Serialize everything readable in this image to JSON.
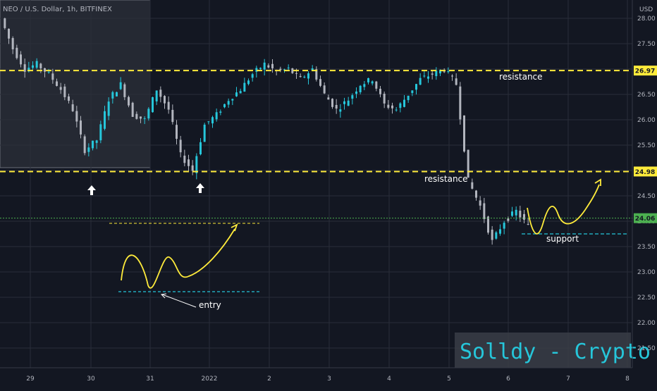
{
  "chart_data": {
    "type": "candlestick",
    "symbol_label": "NEO / U.S. Dollar, 1h, BITFINEX",
    "currency_label": "USD",
    "ylim": [
      21.2,
      28.3
    ],
    "y_ticks": [
      "28.00",
      "27.50",
      "27.00",
      "26.50",
      "26.00",
      "25.50",
      "25.00",
      "24.50",
      "24.00",
      "23.50",
      "23.00",
      "22.50",
      "22.00",
      "21.50"
    ],
    "x_ticks": [
      "29",
      "30",
      "31",
      "2022",
      "2",
      "3",
      "4",
      "5",
      "6",
      "7",
      "8"
    ],
    "candles": [
      {
        "p": 28.0,
        "c": "up"
      },
      {
        "p": 27.4,
        "c": "down"
      },
      {
        "p": 27.0,
        "c": "down"
      },
      {
        "p": 27.1,
        "c": "up"
      },
      {
        "p": 26.9,
        "c": "down"
      },
      {
        "p": 26.6,
        "c": "down"
      },
      {
        "p": 26.2,
        "c": "down"
      },
      {
        "p": 25.4,
        "c": "down"
      },
      {
        "p": 25.6,
        "c": "up"
      },
      {
        "p": 26.4,
        "c": "up"
      },
      {
        "p": 26.7,
        "c": "up"
      },
      {
        "p": 26.1,
        "c": "down"
      },
      {
        "p": 26.0,
        "c": "up"
      },
      {
        "p": 26.6,
        "c": "up"
      },
      {
        "p": 26.2,
        "c": "down"
      },
      {
        "p": 25.3,
        "c": "down"
      },
      {
        "p": 25.0,
        "c": "down"
      },
      {
        "p": 25.9,
        "c": "up"
      },
      {
        "p": 26.1,
        "c": "up"
      },
      {
        "p": 26.4,
        "c": "up"
      },
      {
        "p": 26.6,
        "c": "up"
      },
      {
        "p": 26.9,
        "c": "up"
      },
      {
        "p": 27.1,
        "c": "up"
      },
      {
        "p": 26.95,
        "c": "down"
      },
      {
        "p": 27.0,
        "c": "up"
      },
      {
        "p": 26.8,
        "c": "down"
      },
      {
        "p": 27.0,
        "c": "up"
      },
      {
        "p": 26.5,
        "c": "down"
      },
      {
        "p": 26.2,
        "c": "down"
      },
      {
        "p": 26.4,
        "c": "up"
      },
      {
        "p": 26.7,
        "c": "up"
      },
      {
        "p": 26.8,
        "c": "up"
      },
      {
        "p": 26.3,
        "c": "down"
      },
      {
        "p": 26.2,
        "c": "down"
      },
      {
        "p": 26.5,
        "c": "up"
      },
      {
        "p": 26.8,
        "c": "up"
      },
      {
        "p": 26.9,
        "c": "up"
      },
      {
        "p": 27.0,
        "c": "up"
      },
      {
        "p": 26.7,
        "c": "down"
      },
      {
        "p": 24.8,
        "c": "down"
      },
      {
        "p": 24.3,
        "c": "down"
      },
      {
        "p": 23.6,
        "c": "down"
      },
      {
        "p": 24.0,
        "c": "up"
      },
      {
        "p": 24.2,
        "c": "up"
      },
      {
        "p": 23.9,
        "c": "down"
      }
    ],
    "levels": [
      {
        "name": "resistance-high",
        "value": 26.97,
        "badge": "26.97",
        "color": "#ffeb3b",
        "style": "dashed"
      },
      {
        "name": "resistance-low",
        "value": 24.98,
        "badge": "24.98",
        "color": "#ffeb3b",
        "style": "dashed"
      },
      {
        "name": "last-price",
        "value": 24.06,
        "badge": "24.06",
        "color": "#4caf50",
        "style": "dotted"
      }
    ],
    "annotations": {
      "resistance_1": "resistance",
      "resistance_2": "resistance",
      "support": "support",
      "entry": "entry"
    },
    "watermark": "Solldy - Crypto for U",
    "colors": {
      "background": "#131722",
      "up": "#26c6da",
      "down": "#b2b5be",
      "level": "#ffeb3b",
      "support": "#26c6da",
      "curve": "#ffeb3b",
      "watermark": "#26c6da"
    },
    "grid": "on"
  }
}
